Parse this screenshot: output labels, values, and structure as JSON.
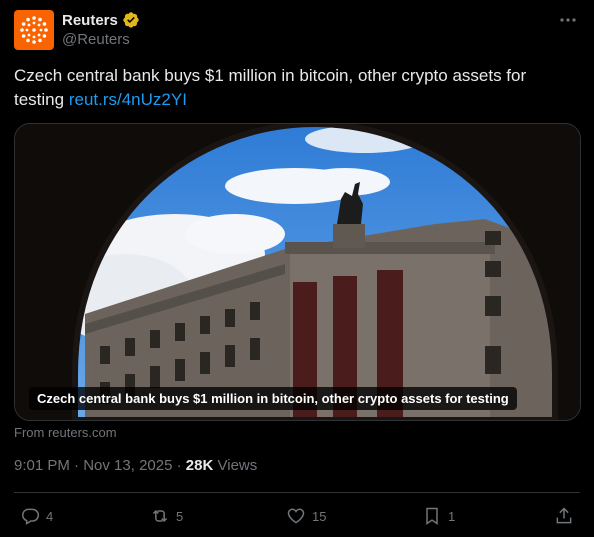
{
  "author": {
    "name": "Reuters",
    "handle": "@Reuters",
    "verified_badge": "gold-verified-badge-icon",
    "avatar_icon": "reuters-logo-icon"
  },
  "tweet": {
    "text": "Czech central bank buys $1 million in bitcoin, other crypto assets for testing",
    "link_text": "reut.rs/4nUz2YI"
  },
  "card": {
    "image_description_icon": "czech-national-bank-building-image",
    "headline": "Czech central bank buys $1 million in bitcoin, other crypto assets for testing",
    "source": "From reuters.com"
  },
  "meta": {
    "time": "9:01 PM",
    "date": "Nov 13, 2025",
    "views_count": "28K",
    "views_label": "Views"
  },
  "actions": {
    "replies": "4",
    "reposts": "5",
    "likes": "15",
    "bookmarks": "1"
  },
  "colors": {
    "background": "#000000",
    "text": "#e7e9ea",
    "muted": "#71767b",
    "link": "#1d9bf0",
    "brand": "#fa6400",
    "verified": "#e2b719"
  }
}
